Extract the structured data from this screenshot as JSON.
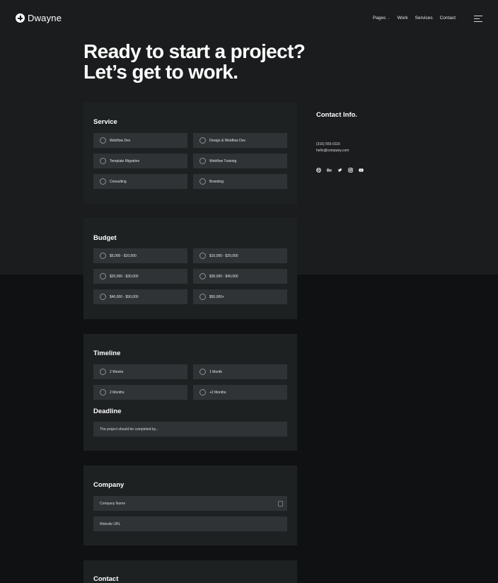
{
  "nav": {
    "brand": "Dwayne",
    "links": [
      "Pages",
      "Work",
      "Services",
      "Contact"
    ]
  },
  "hero": {
    "line1": "Ready to start a project?",
    "line2": "Let’s get to work."
  },
  "service": {
    "title": "Service",
    "options": [
      "Webflow Dev",
      "Design & Webflow Dev",
      "Template Migration",
      "Webflow Training",
      "Consulting",
      "Branding"
    ]
  },
  "budget": {
    "title": "Budget",
    "options": [
      "$5,000 - $10,000",
      "$10,000 - $20,000",
      "$20,000 - $30,000",
      "$30,000 - $40,000",
      "$40,000 - $50,000",
      "$50,000+"
    ]
  },
  "timeline": {
    "title": "Timeline",
    "options": [
      "2 Weeks",
      "1 Month",
      "2 Months",
      "+2 Months"
    ]
  },
  "deadline": {
    "title": "Deadline",
    "placeholder": "The project should be completed by..."
  },
  "company": {
    "title": "Company",
    "name_placeholder": "Company Name",
    "url_placeholder": "Website URL"
  },
  "contact": {
    "title": "Contact"
  },
  "contact_info": {
    "title": "Contact Info.",
    "phone": "(316) 555-0116",
    "email": "hello@company.com",
    "socials": [
      "dribbble-icon",
      "behance-icon",
      "twitter-icon",
      "instagram-icon",
      "youtube-icon"
    ]
  },
  "colors": {
    "page_bg_top": "#1a1c1d",
    "page_bg_bottom": "#0f1112",
    "card_bg": "#1e2122",
    "option_bg": "#2f3336"
  }
}
